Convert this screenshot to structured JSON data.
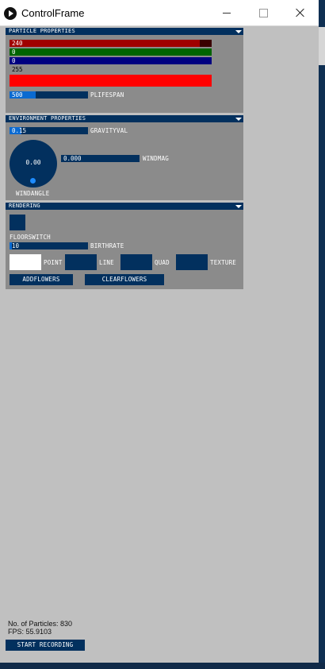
{
  "window": {
    "title": "ControlFrame"
  },
  "particle": {
    "header": "PARTICLE PROPERTIES",
    "red_value": "240",
    "green_value": "0",
    "blue_value": "0",
    "alpha_value": "255",
    "red_level": 0.941,
    "green_level": 0,
    "blue_level": 0,
    "alpha_level": 1.0,
    "preview_color": "#ff0000",
    "plifespan": {
      "value": "500",
      "label": "PLIFESPAN",
      "level": 0.33
    }
  },
  "environment": {
    "header": "ENVIRONMENT PROPERTIES",
    "gravity": {
      "value": "0.15",
      "label": "GRAVITYVAL",
      "level": 0.15
    },
    "windmag": {
      "value": "0.000",
      "label": "WINDMAG",
      "level": 0
    },
    "windangle": {
      "value": "0.00",
      "label": "WINDANGLE"
    }
  },
  "rendering": {
    "header": "RENDERING",
    "floorswitch_label": "FLOORSWITCH",
    "birthrate": {
      "value": "10",
      "label": "BIRTHRATE",
      "level": 0.03
    },
    "modes": {
      "point": "POINT",
      "line": "LINE",
      "quad": "QUAD",
      "texture": "TEXTURE"
    },
    "addflowers_label": "ADDFLOWERS",
    "clearflowers_label": "CLEARFLOWERS"
  },
  "status": {
    "particles": "No. of Particles: 830",
    "fps": "FPS: 55.9103",
    "record_label": "START RECORDING"
  },
  "colors": {
    "panel_dark": "#02305e",
    "slider_fill": "#0a6ad1",
    "red_track": "#a00000",
    "green_track": "#007000",
    "blue_track": "#000080",
    "group_bg": "#8b8b8b"
  }
}
